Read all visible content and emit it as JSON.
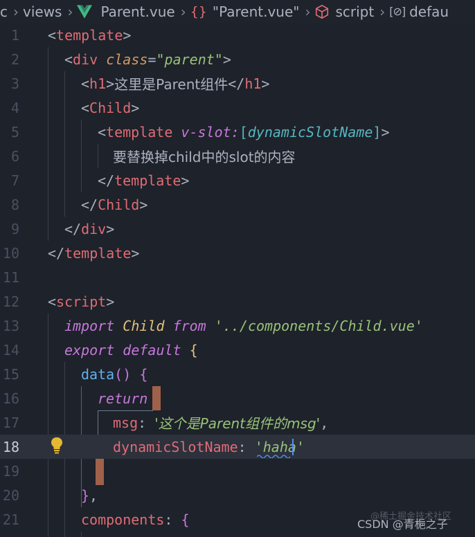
{
  "breadcrumb": {
    "seg1": "c",
    "seg2": "views",
    "seg3": "Parent.vue",
    "seg4": "\"Parent.vue\"",
    "seg5": "script",
    "seg6": "defau"
  },
  "editor": {
    "active_line": 18,
    "lines": [
      {
        "n": "1"
      },
      {
        "n": "2"
      },
      {
        "n": "3"
      },
      {
        "n": "4"
      },
      {
        "n": "5"
      },
      {
        "n": "6"
      },
      {
        "n": "7"
      },
      {
        "n": "8"
      },
      {
        "n": "9"
      },
      {
        "n": "10"
      },
      {
        "n": "11"
      },
      {
        "n": "12"
      },
      {
        "n": "13"
      },
      {
        "n": "14"
      },
      {
        "n": "15"
      },
      {
        "n": "16"
      },
      {
        "n": "17"
      },
      {
        "n": "18"
      },
      {
        "n": "19"
      },
      {
        "n": "20"
      },
      {
        "n": "21"
      }
    ],
    "tokens": {
      "l1_tag": "template",
      "l2_tag": "div",
      "l2_attr": "class",
      "l2_val": "\"parent\"",
      "l3_tag_open": "h1",
      "l3_text": "这里是Parent组件",
      "l3_tag_close": "h1",
      "l4_tag": "Child",
      "l5_tag": "template",
      "l5_dir": "v-slot:",
      "l5_dyn": "dynamicSlotName",
      "l6_text": "要替换掉child中的slot的内容",
      "l7_tag": "template",
      "l8_tag": "Child",
      "l9_tag": "div",
      "l10_tag": "template",
      "l12_tag": "script",
      "l13_import": "import",
      "l13_child": "Child",
      "l13_from": "from",
      "l13_path": "'../components/Child.vue'",
      "l14_export": "export",
      "l14_default": "default",
      "l15_fn": "data",
      "l16_return": "return",
      "l17_key": "msg",
      "l17_val": "'这个是Parent组件的msg'",
      "l18_key": "dynamicSlotName",
      "l18_val_q1": "'",
      "l18_val": "haha",
      "l18_val_q2": "'",
      "l21_key": "components"
    }
  },
  "watermark": {
    "main": "CSDN @青梔之子",
    "faint": "@稀土掘金技术社区"
  },
  "colors": {
    "background": "#1e222a",
    "active_line": "#2c313c",
    "tag": "#e06c75",
    "keyword": "#c678dd",
    "string": "#98c379",
    "function": "#61afef",
    "attribute": "#d19a66"
  }
}
